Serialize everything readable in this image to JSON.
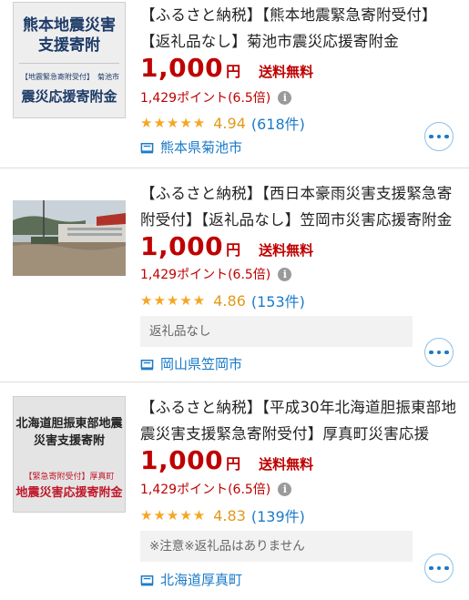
{
  "items": [
    {
      "thumb": {
        "line1": "熊本地震災害",
        "line2": "支援寄附",
        "sub_left": "【地震緊急寄附受付】",
        "sub_right": "菊池市",
        "line3": "震災応援寄附金"
      },
      "title": "【ふるさと納税】【熊本地震緊急寄附受付】【返礼品なし】菊池市震災応援寄附金",
      "price": "1,000",
      "yen": "円",
      "shipping": "送料無料",
      "points": "1,429ポイント(6.5倍)",
      "stars": "★★★★★",
      "score": "4.94",
      "reviews": "(618件)",
      "note": "",
      "location": "熊本県菊池市"
    },
    {
      "thumb": {},
      "title": "【ふるさと納税】【西日本豪雨災害支援緊急寄附受付】【返礼品なし】笠岡市災害応援寄附金",
      "price": "1,000",
      "yen": "円",
      "shipping": "送料無料",
      "points": "1,429ポイント(6.5倍)",
      "stars": "★★★★★",
      "score": "4.86",
      "reviews": "(153件)",
      "note": "返礼品なし",
      "location": "岡山県笠岡市"
    },
    {
      "thumb": {
        "line1": "北海道胆振東部地震",
        "line2": "災害支援寄附",
        "sub_left": "【緊急寄附受付】厚真町",
        "sub_right": "",
        "line3": "地震災害応援寄附金"
      },
      "title": "【ふるさと納税】【平成30年北海道胆振東部地震災害支援緊急寄附受付】厚真町災害応援寄…",
      "price": "1,000",
      "yen": "円",
      "shipping": "送料無料",
      "points": "1,429ポイント(6.5倍)",
      "stars": "★★★★★",
      "score": "4.83",
      "reviews": "(139件)",
      "note": "※注意※返礼品はありません",
      "location": "北海道厚真町"
    }
  ],
  "icons": {
    "info": "info-icon",
    "location": "building-icon",
    "more": "more-dots-icon"
  },
  "colors": {
    "price": "#bf0000",
    "link": "#1a7ac9",
    "star": "#f5a623"
  }
}
